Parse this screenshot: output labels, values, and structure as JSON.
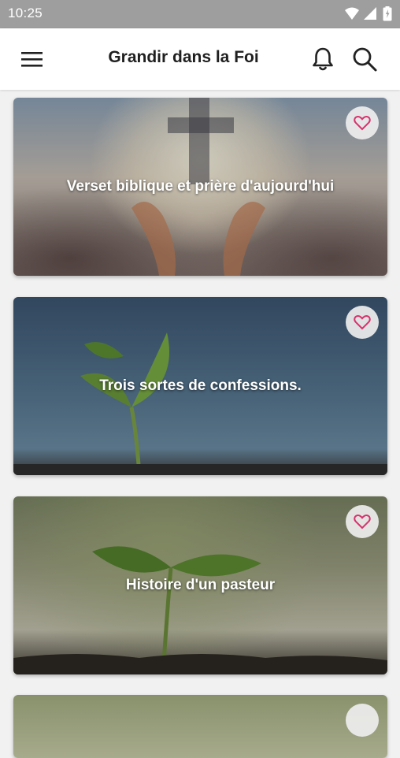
{
  "status_bar": {
    "time": "10:25",
    "icons": [
      "wifi-icon",
      "signal-icon",
      "battery-icon"
    ]
  },
  "app_bar": {
    "title": "Grandir dans la Foi",
    "icons": [
      "menu-icon",
      "bell-icon",
      "search-icon"
    ]
  },
  "cards": [
    {
      "title": "Verset biblique et prière d'aujourd'hui",
      "favorite_icon": "heart-icon"
    },
    {
      "title": "Trois sortes de confessions.",
      "favorite_icon": "heart-icon"
    },
    {
      "title": "Histoire d'un pasteur",
      "favorite_icon": "heart-icon"
    },
    {
      "title": "",
      "favorite_icon": "heart-icon"
    }
  ],
  "colors": {
    "status_bar_bg": "#9e9e9e",
    "app_bar_bg": "#ffffff",
    "page_bg": "#f1f1f1",
    "heart": "#d6336c"
  }
}
